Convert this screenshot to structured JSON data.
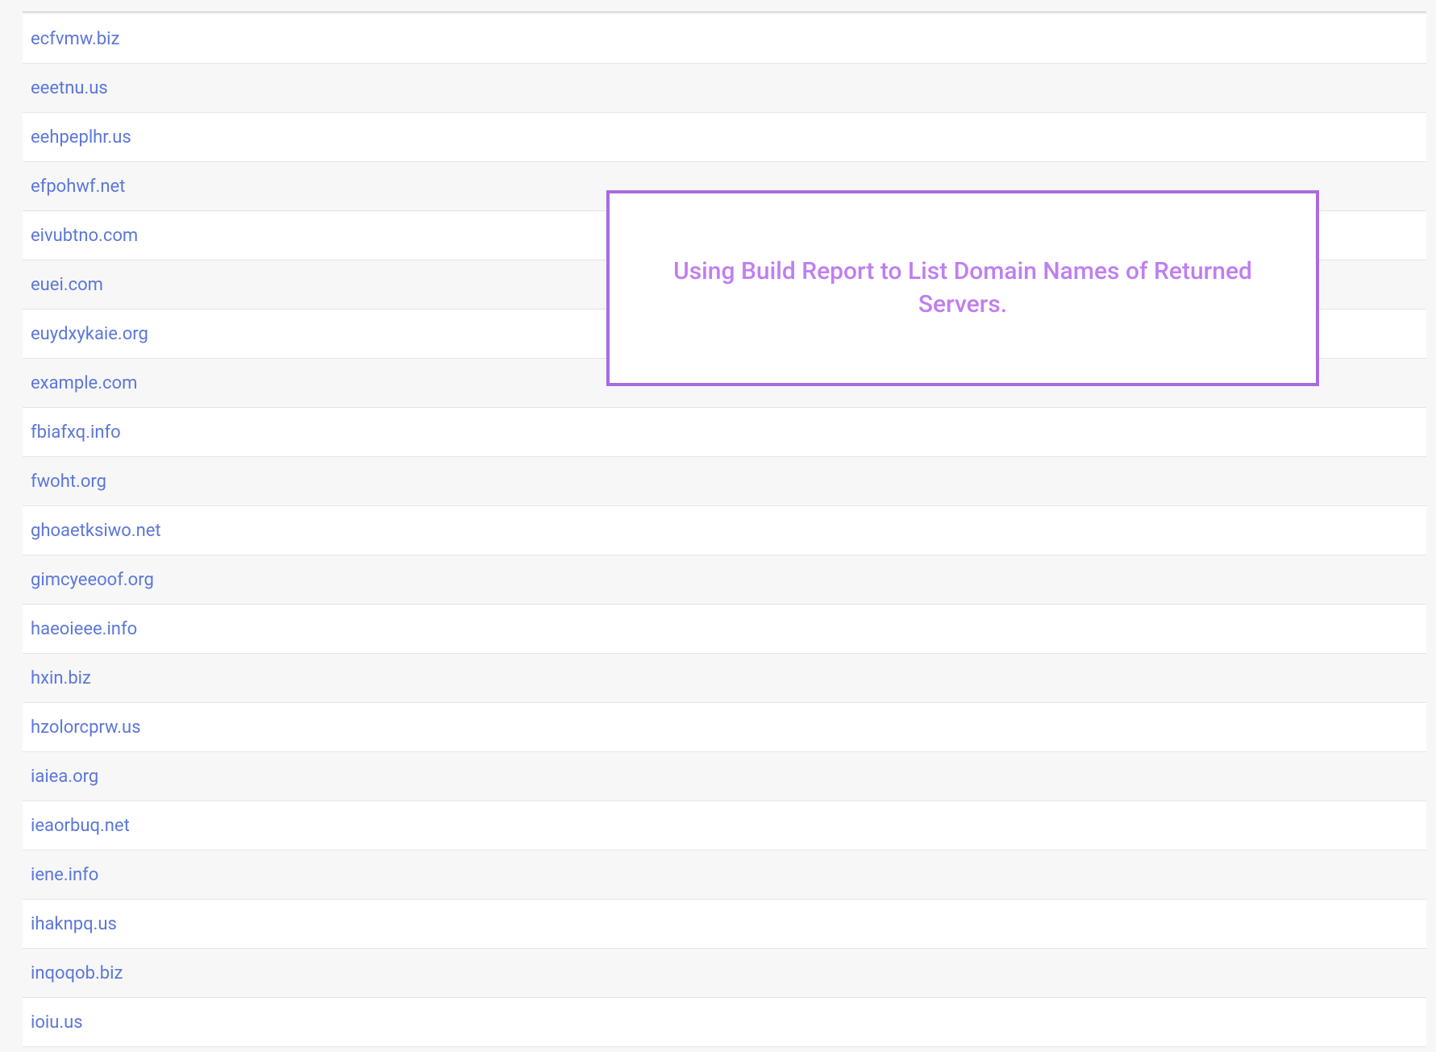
{
  "colors": {
    "link": "#5b77d9",
    "callout_border": "#a96be0",
    "callout_text": "#c07ef0",
    "row_border": "#e3e4e6",
    "bg_alt": "#f7f7f8"
  },
  "callout": {
    "text": "Using Build Report to List Domain Names of Returned Servers."
  },
  "domains": [
    "ecfvmw.biz",
    "eeetnu.us",
    "eehpeplhr.us",
    "efpohwf.net",
    "eivubtno.com",
    "euei.com",
    "euydxykaie.org",
    "example.com",
    "fbiafxq.info",
    "fwoht.org",
    "ghoaetksiwo.net",
    "gimcyeeoof.org",
    "haeoieee.info",
    "hxin.biz",
    "hzolorcprw.us",
    "iaiea.org",
    "ieaorbuq.net",
    "iene.info",
    "ihaknpq.us",
    "inqoqob.biz",
    "ioiu.us"
  ]
}
